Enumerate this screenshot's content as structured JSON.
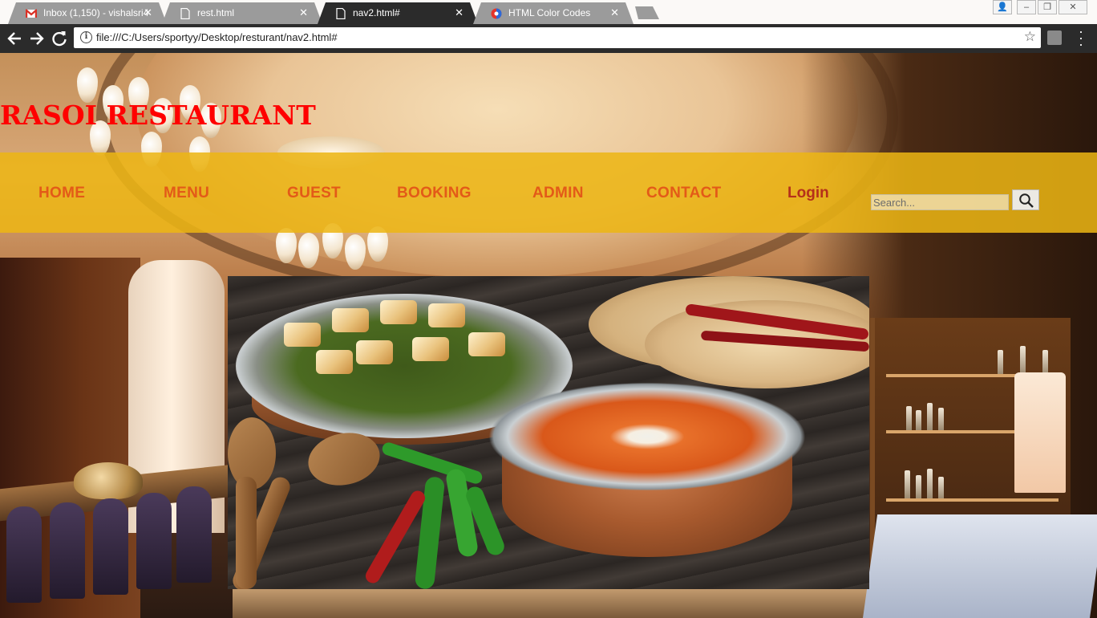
{
  "browser": {
    "tabs": [
      {
        "title": "Inbox (1,150) - vishalsri4",
        "icon": "gmail-icon",
        "active": false
      },
      {
        "title": "rest.html",
        "icon": "page-icon",
        "active": false
      },
      {
        "title": "nav2.html#",
        "icon": "page-icon",
        "active": true
      },
      {
        "title": "HTML Color Codes",
        "icon": "site-icon",
        "active": false
      }
    ],
    "close_glyph": "✕",
    "url": "file:///C:/Users/sportyy/Desktop/resturant/nav2.html#",
    "window_buttons": {
      "user": "👤",
      "minimize": "–",
      "restore": "❐",
      "close": "✕"
    }
  },
  "site": {
    "title": "RASOI RESTAURANT",
    "title_color": "#ff0000",
    "nav": {
      "home": "HOME",
      "menu": "MENU",
      "guest": "GUEST",
      "booking": "BOOKING",
      "admin": "ADMIN",
      "contact": "CONTACT",
      "login": "Login"
    },
    "nav_band_color": "#ecb614",
    "nav_link_color": "#e35a18",
    "search": {
      "placeholder": "Search..."
    }
  },
  "hero": {
    "alt": "Indian curry dishes with roti, chillies and wooden spoons"
  }
}
